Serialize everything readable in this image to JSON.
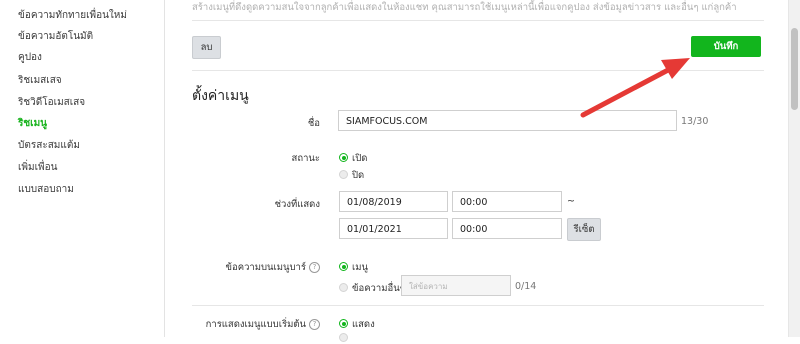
{
  "sidebar": {
    "items": [
      {
        "label": "ข้อความทักทายเพื่อนใหม่"
      },
      {
        "label": "ข้อความอัตโนมัติ"
      },
      {
        "label": "คูปอง"
      },
      {
        "label": "ริชเมสเสจ"
      },
      {
        "label": "ริชวิดีโอเมสเสจ"
      },
      {
        "label": "ริชเมนู",
        "active": true
      },
      {
        "label": "บัตรสะสมแต้ม"
      },
      {
        "label": "เพิ่มเพื่อน"
      },
      {
        "label": "แบบสอบถาม"
      }
    ]
  },
  "header": {
    "description": "สร้างเมนูที่ดึงดูดความสนใจจากลูกค้าเพื่อแสดงในห้องแชท คุณสามารถใช้เมนูเหล่านี้เพื่อแจกคูปอง ส่งข้อมูลข่าวสาร และอื่นๆ แก่ลูกค้า",
    "delete_label": "ลบ",
    "save_label": "บันทึก"
  },
  "form": {
    "section_title": "ตั้งค่าเมนู",
    "name": {
      "label": "ชื่อ",
      "value": "SIAMFOCUS.COM",
      "counter": "13/30"
    },
    "status": {
      "label": "สถานะ",
      "options": [
        "เปิด",
        "ปิด"
      ],
      "selected": "เปิด"
    },
    "period": {
      "label": "ช่วงที่แสดง",
      "start_date": "01/08/2019",
      "start_time": "00:00",
      "separator": "~",
      "end_date": "01/01/2021",
      "end_time": "00:00",
      "reset_label": "รีเซ็ต"
    },
    "menubar_text": {
      "label": "ข้อความบนเมนูบาร์",
      "options": [
        "เมนู",
        "ข้อความอื่นๆ"
      ],
      "selected": "เมนู",
      "placeholder": "ใส่ข้อความ",
      "counter": "0/14"
    },
    "default_display": {
      "label": "การแสดงเมนูแบบเริ่มต้น",
      "options": [
        "แสดง"
      ],
      "selected": "แสดง"
    }
  },
  "colors": {
    "accent": "#12b51d",
    "arrow": "#e53935"
  }
}
